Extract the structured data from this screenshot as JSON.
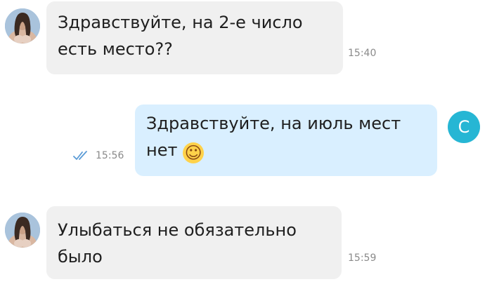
{
  "colors": {
    "incoming_bubble": "#f0f0f0",
    "outgoing_bubble": "#d9efff",
    "contact_avatar": "#26b6d4",
    "read_ticks": "#5a9bd6"
  },
  "messages": [
    {
      "direction": "incoming",
      "text": "Здравствуйте, на 2-е число\nесть место??",
      "time": "15:40",
      "avatar_icon": "user-photo-icon"
    },
    {
      "direction": "outgoing",
      "text": "Здравствуйте, на июль мест\nнет",
      "emoji": "☺",
      "time": "15:56",
      "status_icon": "double-check-icon",
      "avatar_letter": "C"
    },
    {
      "direction": "incoming",
      "text": "Улыбаться не обязательно\nбыло",
      "time": "15:59",
      "avatar_icon": "user-photo-icon"
    }
  ]
}
